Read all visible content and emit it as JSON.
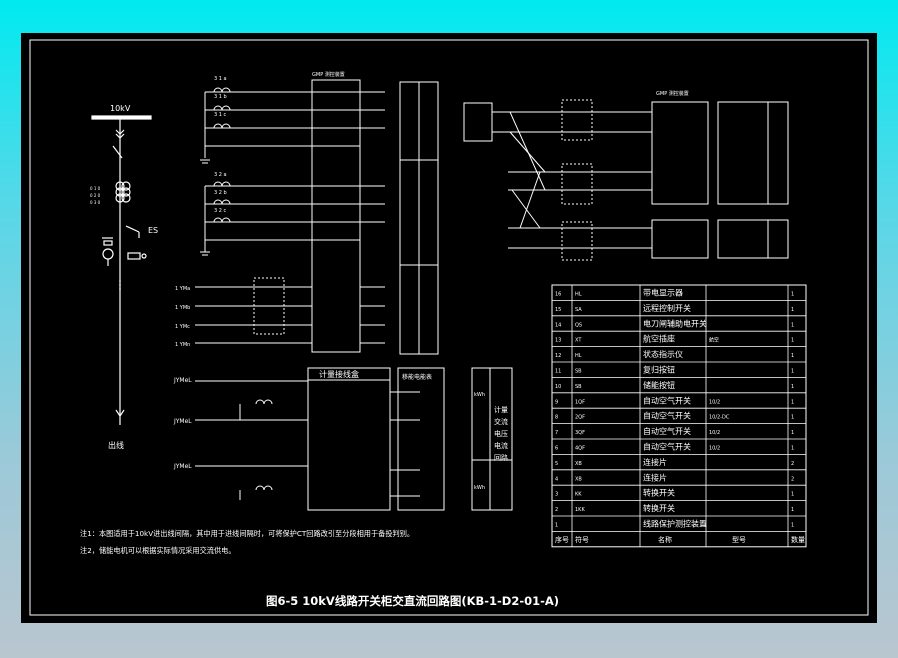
{
  "title": "图6-5 10kV线路开关柜交直流回路图(KB-1-D2-01-A)",
  "colors": {
    "background": "#000000",
    "line": "#ffffff",
    "bus": "#ffffff",
    "frame": "#ffffff",
    "page_bg_top": "#00eaf0",
    "page_bg_bottom": "#b9c6cf"
  },
  "single_line": {
    "bus_label": "10kV",
    "es_label": "ES",
    "outlet_label": "出线"
  },
  "measure_box": {
    "title": "计量接线盒",
    "mobile_title": "移能电能表"
  },
  "left_inputs": [
    "JYMeL",
    "JYMeL",
    "JYMeL"
  ],
  "vertical_labels": {
    "energy_meter": [
      "计量",
      "交流",
      "电压",
      "电流",
      "回路"
    ],
    "kwh_a": "kWh",
    "kwh_b": "kWh"
  },
  "notes": [
    "注1：本图适用于10kV进出线间隔，其中用于进线间隔时，可将保护CT回路改引至分段相用于备投判别。",
    "注2，储能电机可以根据实际情况采用交流供电。"
  ],
  "ct_label": "GMP 测控装置",
  "right_box_label": "GMP 测控装置",
  "table": {
    "headers": [
      "序号",
      "符号",
      "名称",
      "型号",
      "数量"
    ],
    "rows": [
      {
        "no": "16",
        "sym": "HL",
        "name": "带电显示器",
        "model": "",
        "qty": "1"
      },
      {
        "no": "15",
        "sym": "SA",
        "name": "远程控制开关",
        "model": "",
        "qty": "1"
      },
      {
        "no": "14",
        "sym": "QS",
        "name": "电刀闸辅助电开关",
        "model": "",
        "qty": "1"
      },
      {
        "no": "13",
        "sym": "XT",
        "name": "航空插座",
        "model": "航空",
        "qty": "1"
      },
      {
        "no": "12",
        "sym": "HL",
        "name": "状态指示仪",
        "model": "",
        "qty": "1"
      },
      {
        "no": "11",
        "sym": "SB",
        "name": "复归按钮",
        "model": "",
        "qty": "1"
      },
      {
        "no": "10",
        "sym": "SB",
        "name": "储能按钮",
        "model": "",
        "qty": "1"
      },
      {
        "no": "9",
        "sym": "1QF",
        "name": "自动空气开关",
        "model": "10/2",
        "qty": "1"
      },
      {
        "no": "8",
        "sym": "2QF",
        "name": "自动空气开关",
        "model": "10/2-DC",
        "qty": "1"
      },
      {
        "no": "7",
        "sym": "3QF",
        "name": "自动空气开关",
        "model": "10/2",
        "qty": "1"
      },
      {
        "no": "6",
        "sym": "4QF",
        "name": "自动空气开关",
        "model": "10/2",
        "qty": "1"
      },
      {
        "no": "5",
        "sym": "XB",
        "name": "连接片",
        "model": "",
        "qty": "2"
      },
      {
        "no": "4",
        "sym": "XB",
        "name": "连接片",
        "model": "",
        "qty": "2"
      },
      {
        "no": "3",
        "sym": "KK",
        "name": "转换开关",
        "model": "",
        "qty": "1"
      },
      {
        "no": "2",
        "sym": "1KK",
        "name": "转换开关",
        "model": "",
        "qty": "1"
      },
      {
        "no": "1",
        "sym": "",
        "name": "线路保护测控装置",
        "model": "",
        "qty": "1"
      }
    ]
  }
}
